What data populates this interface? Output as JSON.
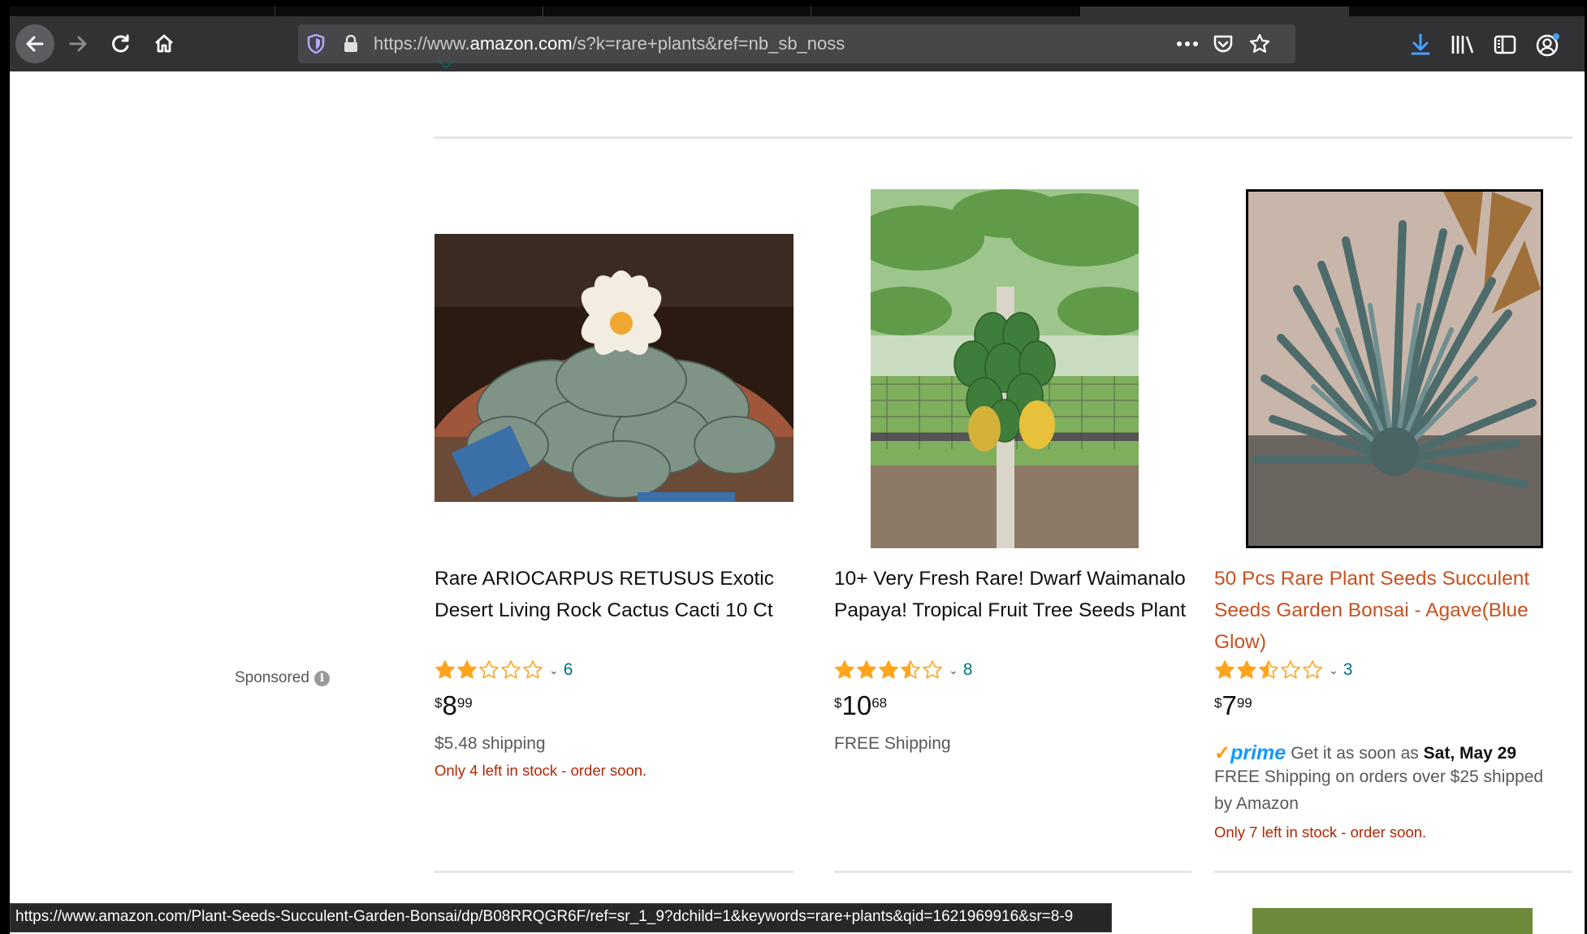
{
  "browser": {
    "url_prefix": "https://www.",
    "url_domain": "amazon.com",
    "url_path": "/s?k=rare+plants&ref=nb_sb_noss",
    "status_url": "https://www.amazon.com/Plant-Seeds-Succulent-Garden-Bonsai/dp/B08RRQGR6F/ref=sr_1_9?dchild=1&keywords=rare+plants&qid=1621969916&sr=8-9"
  },
  "sponsored": {
    "label": "Sponsored"
  },
  "products": [
    {
      "title": "Rare ARIOCARPUS RETUSUS Exotic Desert Living Rock Cactus Cacti 10 Ct",
      "rating": 2.0,
      "review_count": "6",
      "price_symbol": "$",
      "price_whole": "8",
      "price_fraction": "99",
      "shipping": "$5.48 shipping",
      "stock": "Only 4 left in stock - order soon."
    },
    {
      "title": "10+ Very Fresh Rare! Dwarf Waimanalo Papaya! Tropical Fruit Tree Seeds Plant",
      "rating": 3.5,
      "review_count": "8",
      "price_symbol": "$",
      "price_whole": "10",
      "price_fraction": "68",
      "shipping": "FREE Shipping"
    },
    {
      "title": "50 Pcs Rare Plant Seeds Succulent Seeds Garden Bonsai - Agave(Blue Glow)",
      "rating": 2.5,
      "review_count": "3",
      "price_symbol": "$",
      "price_whole": "7",
      "price_fraction": "99",
      "prime_label": "prime",
      "delivery_prefix": "Get it as soon as",
      "delivery_date": "Sat, May 29",
      "shipping_line1": "FREE Shipping on orders over $25 shipped",
      "shipping_line2": "by Amazon",
      "stock": "Only 7 left in stock - order soon."
    }
  ],
  "colors": {
    "star": "#ffa41c",
    "link": "#007185",
    "title_hover": "#c7511f",
    "stock_red": "#b12704"
  }
}
